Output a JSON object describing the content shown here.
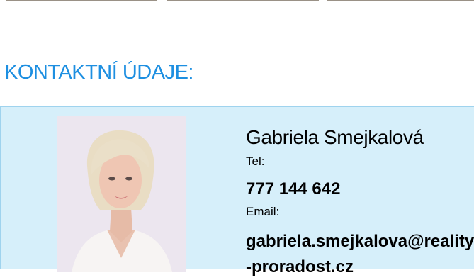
{
  "section": {
    "heading": "KONTAKTNÍ ÚDAJE:"
  },
  "contact": {
    "name": "Gabriela Smejkalová",
    "tel_label": "Tel:",
    "phone": "777 144 642",
    "email_label": "Email:",
    "email": "gabriela.smejkalova@realit​y-proradost.cz",
    "photo_icon": "agent-portrait"
  },
  "colors": {
    "heading": "#1d8fe1",
    "card_background": "#d6effa",
    "card_border": "#9fd3ee"
  }
}
